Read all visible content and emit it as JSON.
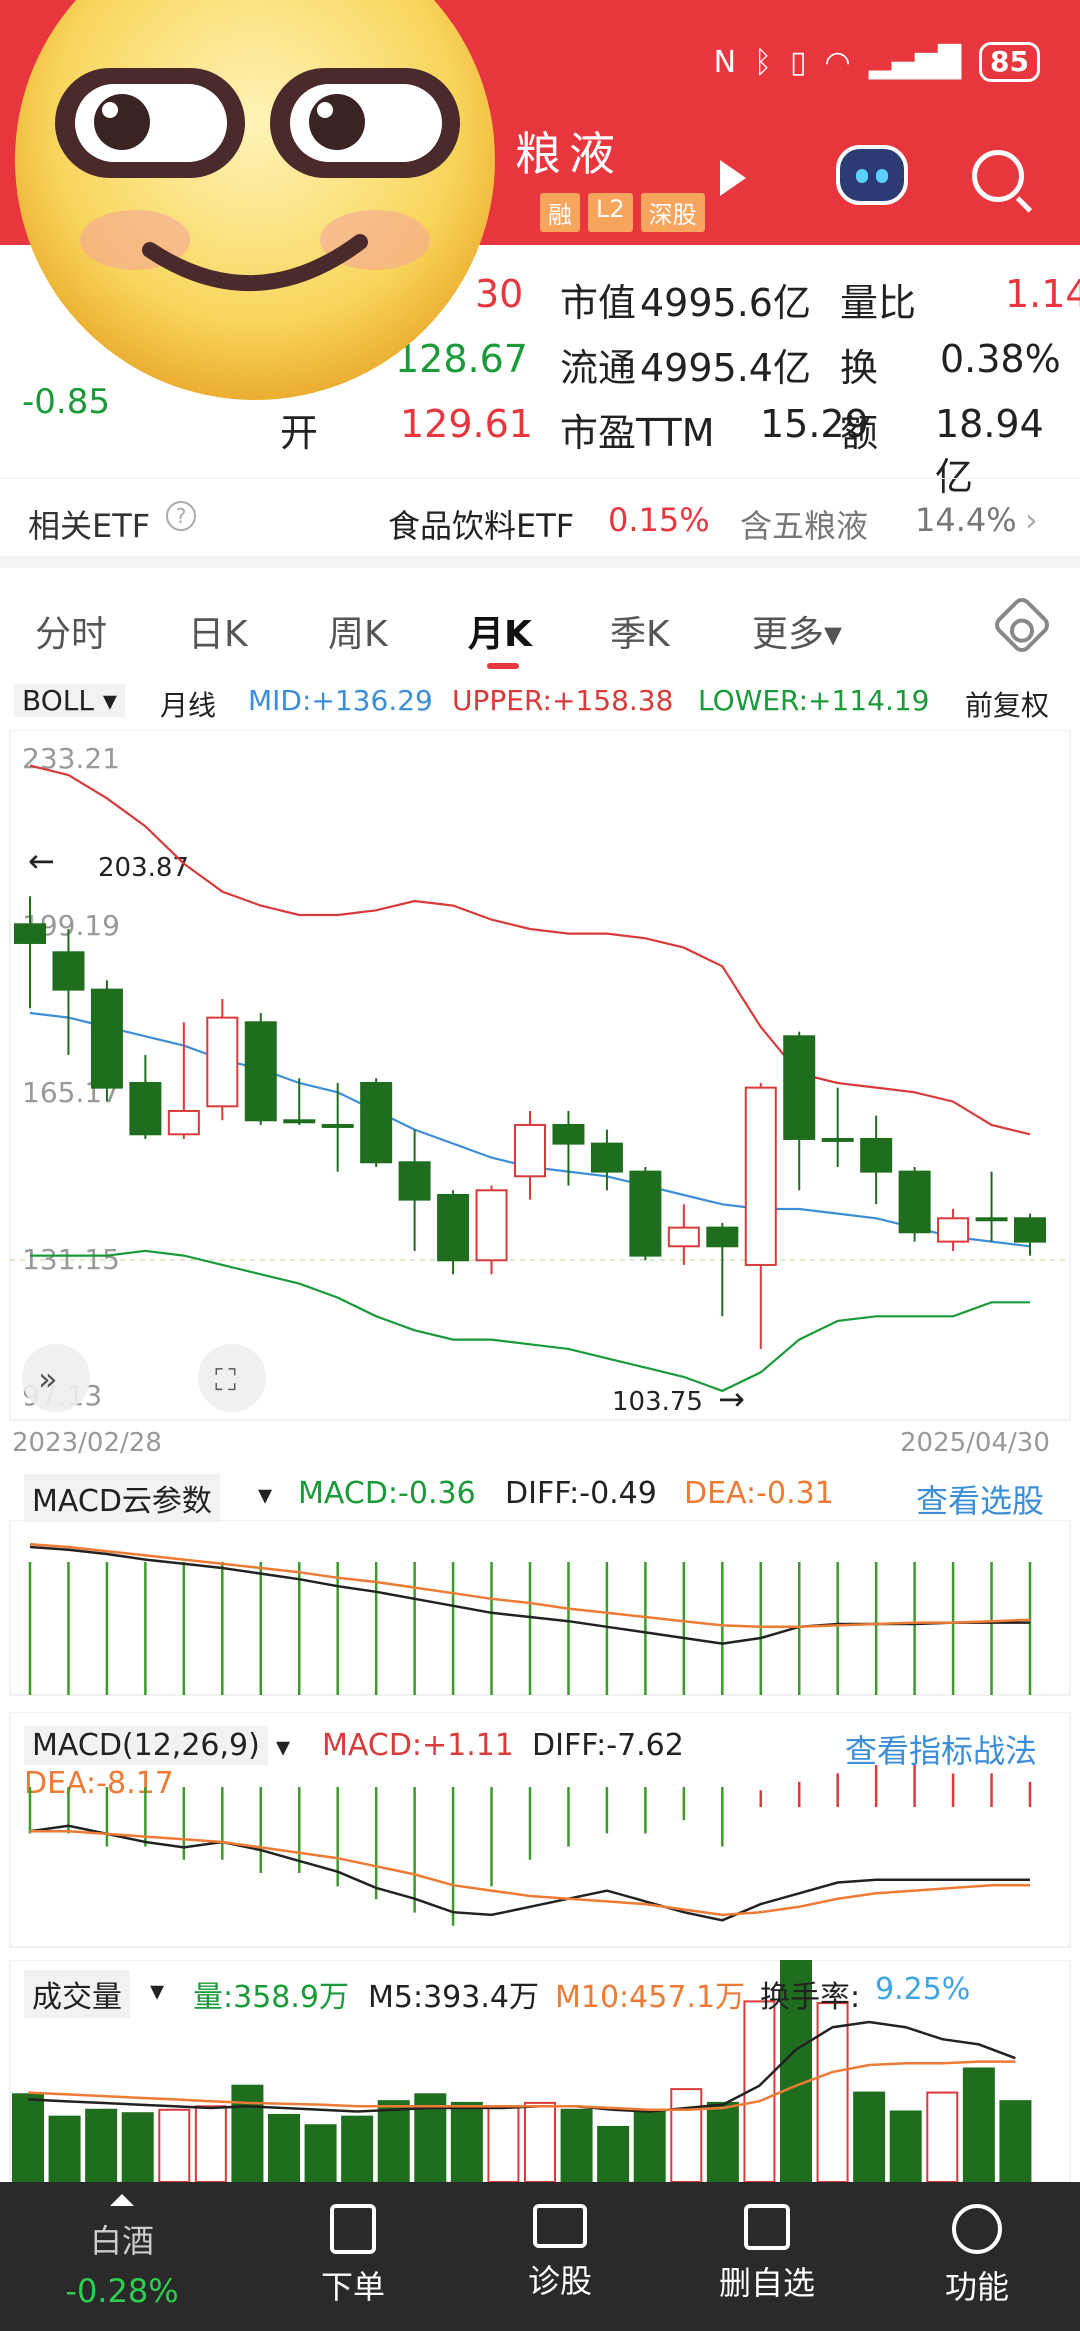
{
  "status_bar": {
    "battery": "85"
  },
  "header": {
    "stock_name": "粮液",
    "tags": [
      "融",
      "L2",
      "深股"
    ]
  },
  "quote": {
    "change": "-0.85",
    "row1": {
      "partial_value": "30",
      "label1": "市值",
      "value1": "4995.6亿",
      "label2": "量比",
      "value2": "1.14"
    },
    "row2": {
      "partial_value": "128.67",
      "label1": "流通",
      "value1": "4995.4亿",
      "label2": "换",
      "value2": "0.38%"
    },
    "row3": {
      "label0": "开",
      "value0": "129.61",
      "label1": "市盈TTM",
      "value1": "15.29",
      "label2": "额",
      "value2": "18.94亿"
    }
  },
  "etf_row": {
    "label": "相关ETF",
    "etf_name": "食品饮料ETF",
    "etf_change": "0.15%",
    "holding_text": "含五粮液",
    "holding_pct": "14.4%"
  },
  "tabs": [
    "分时",
    "日K",
    "周K",
    "月K",
    "季K",
    "更多▾"
  ],
  "boll": {
    "select": "BOLL ▾",
    "period": "月线",
    "mid": "MID:+136.29",
    "upper": "UPPER:+158.38",
    "lower": "LOWER:+114.19",
    "adjust": "前复权"
  },
  "chart_data": [
    {
      "type": "candlestick",
      "y_ticks": [
        "233.21",
        "199.19",
        "165.17",
        "131.15",
        "97.13"
      ],
      "ylim": [
        97.13,
        233.21
      ],
      "x_start": "2023/02/28",
      "x_end": "2025/04/30",
      "annotations": [
        "203.87",
        "103.75"
      ],
      "candles": [
        {
          "o": 198,
          "c": 194,
          "h": 204,
          "l": 180
        },
        {
          "o": 192,
          "c": 184,
          "h": 197,
          "l": 170
        },
        {
          "o": 184,
          "c": 163,
          "h": 186,
          "l": 160
        },
        {
          "o": 164,
          "c": 153,
          "h": 170,
          "l": 152
        },
        {
          "o": 153,
          "c": 158,
          "h": 177,
          "l": 152
        },
        {
          "o": 159,
          "c": 178,
          "h": 182,
          "l": 156
        },
        {
          "o": 177,
          "c": 156,
          "h": 179,
          "l": 155
        },
        {
          "o": 156,
          "c": 156,
          "h": 165,
          "l": 155
        },
        {
          "o": 155,
          "c": 155,
          "h": 164,
          "l": 145
        },
        {
          "o": 164,
          "c": 147,
          "h": 165,
          "l": 146
        },
        {
          "o": 147,
          "c": 139,
          "h": 154,
          "l": 128
        },
        {
          "o": 140,
          "c": 126,
          "h": 141,
          "l": 123
        },
        {
          "o": 126,
          "c": 141,
          "h": 142,
          "l": 123
        },
        {
          "o": 144,
          "c": 155,
          "h": 158,
          "l": 139
        },
        {
          "o": 155,
          "c": 151,
          "h": 158,
          "l": 142
        },
        {
          "o": 151,
          "c": 145,
          "h": 154,
          "l": 141
        },
        {
          "o": 145,
          "c": 127,
          "h": 146,
          "l": 126
        },
        {
          "o": 129,
          "c": 133,
          "h": 138,
          "l": 125
        },
        {
          "o": 133,
          "c": 129,
          "h": 134,
          "l": 114
        },
        {
          "o": 125,
          "c": 163,
          "h": 164,
          "l": 107
        },
        {
          "o": 174,
          "c": 152,
          "h": 175,
          "l": 141
        },
        {
          "o": 152,
          "c": 152,
          "h": 163,
          "l": 146
        },
        {
          "o": 152,
          "c": 145,
          "h": 157,
          "l": 138
        },
        {
          "o": 145,
          "c": 132,
          "h": 146,
          "l": 130
        },
        {
          "o": 130,
          "c": 135,
          "h": 137,
          "l": 128
        },
        {
          "o": 135,
          "c": 135,
          "h": 145,
          "l": 130
        },
        {
          "o": 135,
          "c": 130,
          "h": 136,
          "l": 127
        }
      ],
      "series": [
        {
          "name": "UPPER",
          "values": [
            232,
            230,
            225,
            219,
            211,
            205,
            202,
            200,
            200,
            201,
            203,
            202,
            199,
            197,
            196,
            196,
            195,
            193,
            189,
            176,
            166,
            164,
            163,
            162,
            160,
            155,
            153
          ]
        },
        {
          "name": "MID",
          "values": [
            179,
            178,
            176,
            174,
            172,
            169,
            167,
            164,
            162,
            158,
            154,
            151,
            148,
            146,
            145,
            144,
            142,
            140,
            138,
            137,
            137,
            136,
            135,
            133,
            131,
            130,
            129
          ]
        },
        {
          "name": "LOWER",
          "values": [
            127,
            127,
            127,
            128,
            127,
            125,
            123,
            121,
            118,
            114,
            111,
            109,
            109,
            108,
            107,
            105,
            103,
            101,
            98,
            102,
            109,
            113,
            114,
            114,
            114,
            117,
            117
          ]
        }
      ]
    },
    {
      "type": "line",
      "title": "MACD云参数",
      "labels": {
        "macd": "MACD:-0.36",
        "diff": "DIFF:-0.49",
        "dea": "DEA:-0.31",
        "link": "查看选股"
      },
      "series": [
        {
          "name": "DIFF",
          "values": [
            0.95,
            0.93,
            0.9,
            0.86,
            0.83,
            0.8,
            0.76,
            0.72,
            0.67,
            0.63,
            0.58,
            0.53,
            0.48,
            0.45,
            0.42,
            0.38,
            0.34,
            0.3,
            0.26,
            0.3,
            0.38,
            0.4,
            0.4,
            0.4,
            0.41,
            0.41,
            0.41
          ]
        },
        {
          "name": "DEA",
          "values": [
            0.97,
            0.95,
            0.92,
            0.89,
            0.86,
            0.83,
            0.8,
            0.77,
            0.73,
            0.7,
            0.66,
            0.62,
            0.58,
            0.55,
            0.51,
            0.48,
            0.45,
            0.42,
            0.39,
            0.38,
            0.38,
            0.39,
            0.4,
            0.41,
            0.41,
            0.42,
            0.43
          ]
        }
      ]
    },
    {
      "type": "line",
      "title": "MACD(12,26,9)",
      "labels": {
        "macd": "MACD:+1.11",
        "diff": "DIFF:-7.62",
        "dea": "DEA:-8.17",
        "link": "查看指标战法"
      },
      "bars": [
        -2,
        -2,
        -3,
        -3,
        -4,
        -4,
        -5,
        -5,
        -6,
        -7,
        -8,
        -9,
        -6,
        -4,
        -3,
        -2,
        -2,
        -1,
        -3,
        2,
        3,
        4,
        5,
        5,
        4,
        4,
        3
      ],
      "series": [
        {
          "name": "DIFF",
          "values": [
            4,
            6,
            3,
            0,
            -2,
            0,
            -3,
            -7,
            -11,
            -17,
            -21,
            -26,
            -27,
            -24,
            -21,
            -18,
            -22,
            -26,
            -29,
            -23,
            -19,
            -15,
            -14,
            -14,
            -14,
            -14,
            -14
          ]
        },
        {
          "name": "DEA",
          "values": [
            4,
            4,
            3,
            2,
            1,
            0,
            -2,
            -4,
            -6,
            -9,
            -12,
            -16,
            -18,
            -20,
            -21,
            -22,
            -23,
            -25,
            -27,
            -26,
            -24,
            -21,
            -19,
            -18,
            -17,
            -16,
            -16
          ]
        }
      ]
    },
    {
      "type": "bar",
      "title": "成交量",
      "labels": {
        "vol": "量:358.9万",
        "m5": "M5:393.4万",
        "m10": "M10:457.1万",
        "turnover_label": "换手率:",
        "turnover": "9.25%"
      },
      "values": [
        510,
        380,
        420,
        400,
        420,
        440,
        560,
        390,
        330,
        380,
        470,
        510,
        460,
        440,
        460,
        420,
        320,
        420,
        540,
        460,
        1050,
        1630,
        1040,
        520,
        410,
        520,
        660,
        470
      ],
      "rising": [
        false,
        false,
        false,
        false,
        true,
        true,
        false,
        false,
        false,
        false,
        false,
        false,
        false,
        true,
        true,
        false,
        false,
        false,
        true,
        false,
        true,
        false,
        true,
        false,
        false,
        true,
        false,
        false
      ],
      "series": [
        {
          "name": "M5",
          "values": [
            480,
            470,
            460,
            450,
            440,
            430,
            440,
            430,
            420,
            410,
            420,
            430,
            430,
            430,
            440,
            440,
            420,
            410,
            430,
            450,
            560,
            770,
            900,
            930,
            900,
            830,
            800,
            720
          ]
        },
        {
          "name": "M10",
          "values": [
            520,
            510,
            500,
            490,
            480,
            470,
            460,
            455,
            450,
            440,
            440,
            440,
            440,
            440,
            440,
            440,
            430,
            420,
            420,
            430,
            470,
            560,
            640,
            680,
            690,
            690,
            700,
            700
          ]
        }
      ]
    }
  ],
  "bottom_bar": {
    "sector_name": "白酒",
    "sector_change": "-0.28%",
    "items": [
      "下单",
      "诊股",
      "删自选",
      "功能"
    ]
  }
}
